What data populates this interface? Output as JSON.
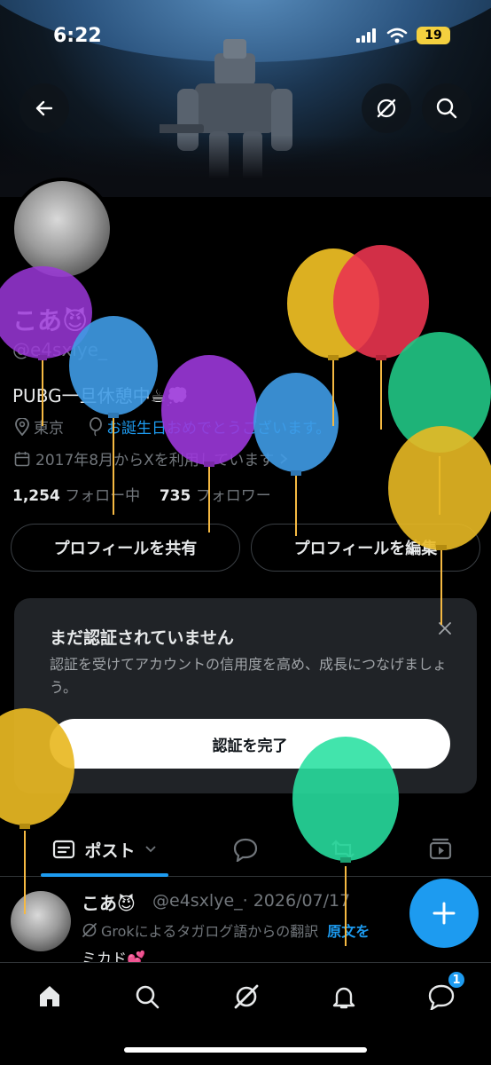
{
  "status_bar": {
    "time": "6:22",
    "battery": "19"
  },
  "profile": {
    "name": "こあ😈",
    "handle": "@e4sxlye_",
    "bio": "PUBG一旦休憩中☕💭",
    "location": "東京",
    "birthday_text": "お誕生日おめでとうございます。",
    "joined": "2017年8月からXを利用しています",
    "following_count": "1,254",
    "following_label": "フォロー中",
    "followers_count": "735",
    "followers_label": "フォロワー"
  },
  "buttons": {
    "share": "プロフィールを共有",
    "edit": "プロフィールを編集"
  },
  "verify_card": {
    "title": "まだ認証されていません",
    "description": "認証を受けてアカウントの信用度を高め、成長につなげましょう。",
    "button": "認証を完了"
  },
  "tabs": {
    "posts": "ポスト"
  },
  "post": {
    "name": "こあ😈",
    "handle_date": "@e4sxlye_· 2026/07/17",
    "translation_note": "Grokによるタガログ語からの翻訳",
    "show_original": "原文を",
    "body": "ミカド💕"
  },
  "nav": {
    "notifications_badge": "1"
  },
  "colors": {
    "accent": "#1d9bf0",
    "background": "#000000",
    "card": "#202327"
  },
  "icons": [
    "back-arrow-icon",
    "grok-icon",
    "search-icon",
    "location-icon",
    "balloon-icon",
    "calendar-icon",
    "chevron-right-icon",
    "close-icon",
    "posts-icon",
    "chevron-down-icon",
    "reply-icon",
    "retweet-icon",
    "media-icon",
    "plus-icon",
    "home-icon",
    "bell-icon",
    "messages-icon"
  ]
}
